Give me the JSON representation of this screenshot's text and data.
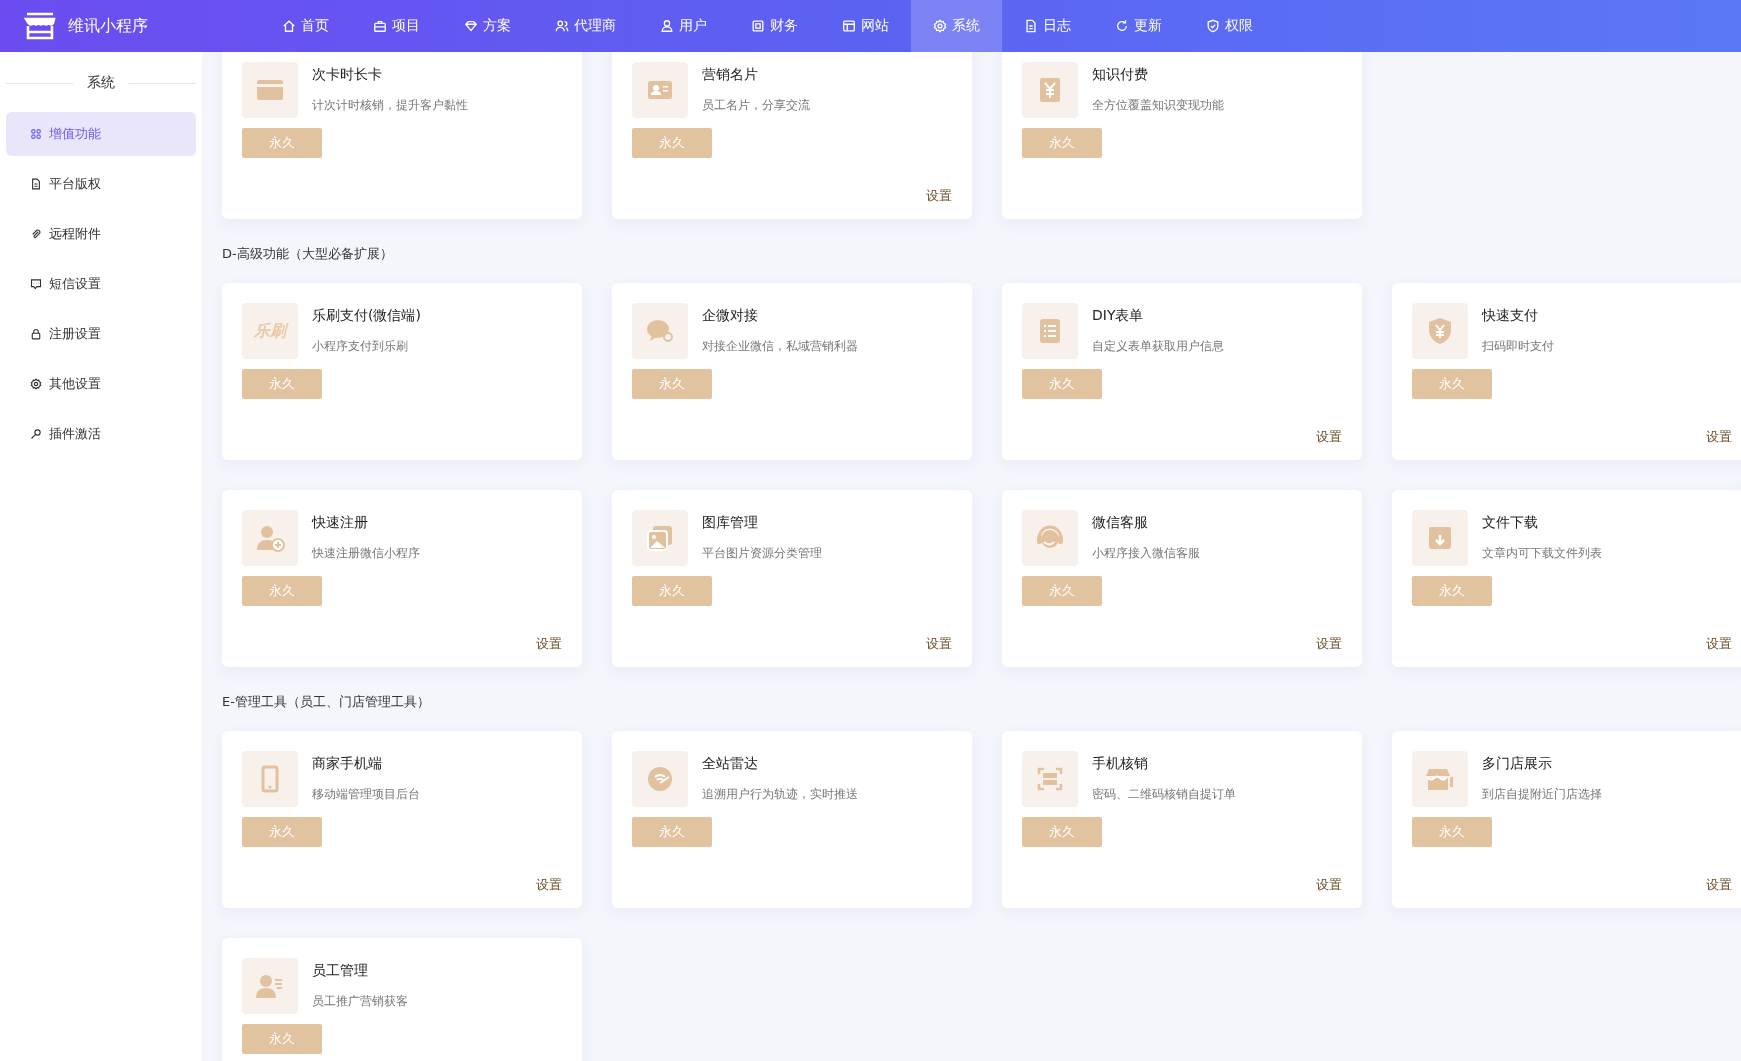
{
  "app": {
    "name": "维讯小程序"
  },
  "nav": [
    {
      "label": "首页",
      "selected": false
    },
    {
      "label": "项目",
      "selected": false
    },
    {
      "label": "方案",
      "selected": false
    },
    {
      "label": "代理商",
      "selected": false
    },
    {
      "label": "用户",
      "selected": false
    },
    {
      "label": "财务",
      "selected": false
    },
    {
      "label": "网站",
      "selected": false
    },
    {
      "label": "系统",
      "selected": true
    },
    {
      "label": "日志",
      "selected": false
    },
    {
      "label": "更新",
      "selected": false
    },
    {
      "label": "权限",
      "selected": false
    }
  ],
  "sidebar": {
    "title": "系统",
    "items": [
      {
        "label": "增值功能",
        "selected": true
      },
      {
        "label": "平台版权",
        "selected": false
      },
      {
        "label": "远程附件",
        "selected": false
      },
      {
        "label": "短信设置",
        "selected": false
      },
      {
        "label": "注册设置",
        "selected": false
      },
      {
        "label": "其他设置",
        "selected": false
      },
      {
        "label": "插件激活",
        "selected": false
      }
    ]
  },
  "sections": [
    {
      "cards": [
        {
          "title": "次卡时长卡",
          "desc": "计次计时核销，提升客户黏性",
          "badge": "永久"
        },
        {
          "title": "营销名片",
          "desc": "员工名片，分享交流",
          "badge": "永久",
          "settings": "设置"
        },
        {
          "title": "知识付费",
          "desc": "全方位覆盖知识变现功能",
          "badge": "永久"
        }
      ]
    },
    {
      "heading": "D-高级功能（大型必备扩展）",
      "cards": [
        {
          "logo_text": "乐刷",
          "title": "乐刷支付(微信端)",
          "desc": "小程序支付到乐刷",
          "badge": "永久"
        },
        {
          "title": "企微对接",
          "desc": "对接企业微信，私域营销利器",
          "badge": "永久"
        },
        {
          "title": "DIY表单",
          "desc": "自定义表单获取用户信息",
          "badge": "永久",
          "settings": "设置"
        },
        {
          "title": "快速支付",
          "desc": "扫码即时支付",
          "badge": "永久",
          "settings": "设置"
        },
        {
          "title": "快速注册",
          "desc": "快速注册微信小程序",
          "badge": "永久",
          "settings": "设置"
        },
        {
          "title": "图库管理",
          "desc": "平台图片资源分类管理",
          "badge": "永久",
          "settings": "设置"
        },
        {
          "title": "微信客服",
          "desc": "小程序接入微信客服",
          "badge": "永久",
          "settings": "设置"
        },
        {
          "title": "文件下载",
          "desc": "文章内可下载文件列表",
          "badge": "永久",
          "settings": "设置"
        }
      ]
    },
    {
      "heading": "E-管理工具（员工、门店管理工具）",
      "cards": [
        {
          "title": "商家手机端",
          "desc": "移动端管理项目后台",
          "badge": "永久",
          "settings": "设置"
        },
        {
          "title": "全站雷达",
          "desc": "追溯用户行为轨迹，实时推送",
          "badge": "永久"
        },
        {
          "title": "手机核销",
          "desc": "密码、二维码核销自提订单",
          "badge": "永久",
          "settings": "设置"
        },
        {
          "title": "多门店展示",
          "desc": "到店自提附近门店选择",
          "badge": "永久",
          "settings": "设置"
        },
        {
          "title": "员工管理",
          "desc": "员工推广营销获客",
          "badge": "永久"
        }
      ]
    }
  ]
}
